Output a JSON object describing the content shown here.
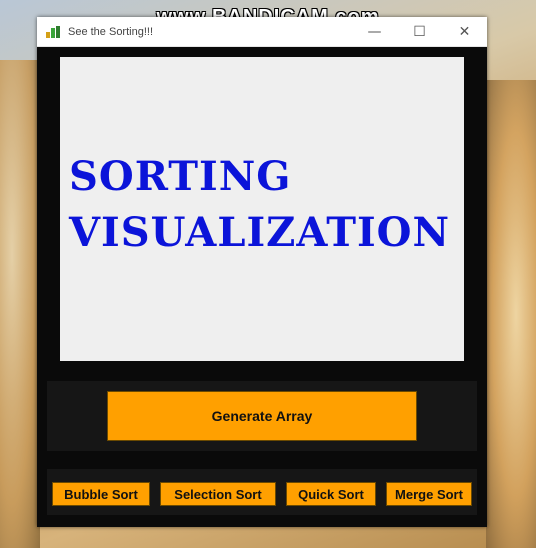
{
  "watermark": "www.BANDICAM.com",
  "window": {
    "title": "See the Sorting!!!",
    "app_icon": "bar-chart-icon",
    "controls": {
      "minimize": "—",
      "maximize": "☐",
      "close": "✕"
    }
  },
  "canvas": {
    "line1": "SORTING",
    "line2": "VISUALIZATION",
    "text_color": "#0b14d9",
    "background": "#efefef"
  },
  "generate": {
    "label": "Generate Array"
  },
  "sort_buttons": {
    "bubble": "Bubble Sort",
    "selection": "Selection Sort",
    "quick": "Quick Sort",
    "merge": "Merge Sort"
  },
  "colors": {
    "button": "#ffa000",
    "window_bg": "#0a0a0a",
    "panel_bg": "#161616"
  }
}
